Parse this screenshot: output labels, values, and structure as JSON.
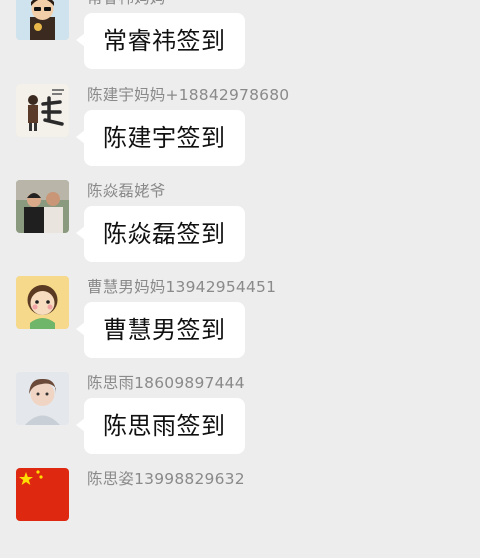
{
  "messages": [
    {
      "sender": "常睿祎妈妈",
      "text": "常睿祎签到",
      "avatar_icon": "cartoon-boy-avatar-icon"
    },
    {
      "sender": "陈建宇妈妈+18842978680",
      "text": "陈建宇签到",
      "avatar_icon": "calligraphy-avatar-icon"
    },
    {
      "sender": "陈焱磊姥爷",
      "text": "陈焱磊签到",
      "avatar_icon": "family-photo-avatar-icon"
    },
    {
      "sender": "曹慧男妈妈13942954451",
      "text": "曹慧男签到",
      "avatar_icon": "cartoon-girl-avatar-icon"
    },
    {
      "sender": "陈思雨18609897444",
      "text": "陈思雨签到",
      "avatar_icon": "portrait-avatar-icon"
    },
    {
      "sender": "陈思姿13998829632",
      "text": "",
      "avatar_icon": "flag-avatar-icon"
    }
  ],
  "colors": {
    "background": "#ededed",
    "bubble": "#ffffff",
    "sender_text": "#8a8a8a",
    "message_text": "#111111"
  }
}
